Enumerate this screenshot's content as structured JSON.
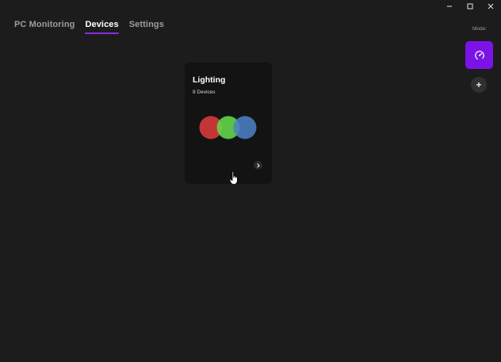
{
  "window_controls": {
    "minimize": "minimize-icon",
    "maximize": "maximize-icon",
    "close": "close-icon"
  },
  "tabs": [
    {
      "label": "PC Monitoring",
      "active": false
    },
    {
      "label": "Devices",
      "active": true
    },
    {
      "label": "Settings",
      "active": false
    }
  ],
  "mode": {
    "label": "Mode:",
    "current_icon": "performance-dial-icon",
    "add_icon": "plus-icon"
  },
  "device_card": {
    "title": "Lighting",
    "subtitle": "8 Devices",
    "illustration": "rgb-circles-icon",
    "arrow_icon": "chevron-right-icon"
  },
  "colors": {
    "background": "#1c1c1d",
    "card": "#131314",
    "accent": "#7c13e6",
    "tab_underline": "#8a2be2",
    "red": "#d43a3a",
    "green": "#63d94a",
    "blue": "#4a7fc4"
  }
}
